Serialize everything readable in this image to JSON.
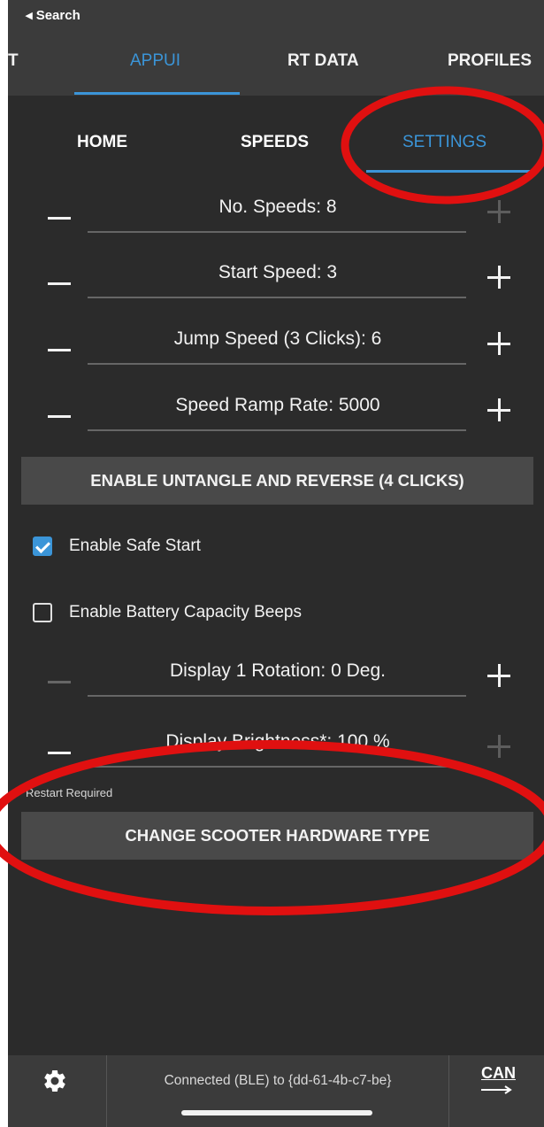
{
  "status_bar": {
    "back_label": "◂ Search"
  },
  "top_tabs": [
    {
      "label": "T",
      "active": false
    },
    {
      "label": "APPUI",
      "active": true
    },
    {
      "label": "RT DATA",
      "active": false
    },
    {
      "label": "PROFILES",
      "active": false
    }
  ],
  "sub_tabs": [
    {
      "label": "HOME",
      "active": false
    },
    {
      "label": "SPEEDS",
      "active": false
    },
    {
      "label": "SETTINGS",
      "active": true
    }
  ],
  "settings": {
    "no_speeds": "No. Speeds: 8",
    "start_speed": "Start Speed: 3",
    "jump_speed": "Jump Speed (3 Clicks): 6",
    "speed_ramp": "Speed Ramp Rate: 5000",
    "untangle_button": "ENABLE UNTANGLE AND REVERSE (4 CLICKS)",
    "safe_start": {
      "label": "Enable Safe Start",
      "checked": true
    },
    "battery_beeps": {
      "label": "Enable Battery Capacity Beeps",
      "checked": false
    },
    "display_rotation": "Display 1 Rotation: 0 Deg.",
    "display_brightness": "Display Brightness*: 100 %",
    "restart_note": "Restart Required",
    "hardware_button": "CHANGE SCOOTER HARDWARE TYPE"
  },
  "bottom_bar": {
    "connection_text": "Connected (BLE) to {dd-61-4b-c7-be}",
    "can_label": "CAN"
  },
  "colors": {
    "accent": "#3b95d8",
    "background": "#2b2b2b",
    "annotation": "#e01010"
  }
}
